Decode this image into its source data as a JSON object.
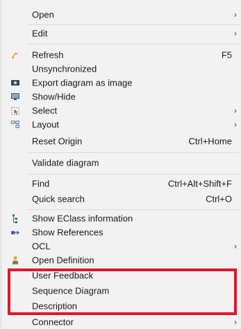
{
  "menu": {
    "items": [
      {
        "label": "Open",
        "shortcut": "",
        "arrow": "›",
        "icon": ""
      },
      {
        "label": "Edit",
        "shortcut": "",
        "arrow": "›",
        "icon": ""
      },
      {
        "label": "Refresh",
        "shortcut": "F5",
        "arrow": "",
        "icon": "refresh-icon"
      },
      {
        "label": "Unsynchronized",
        "shortcut": "",
        "arrow": "",
        "icon": ""
      },
      {
        "label": "Export diagram as image",
        "shortcut": "",
        "arrow": "",
        "icon": "camera-icon"
      },
      {
        "label": "Show/Hide",
        "shortcut": "",
        "arrow": "",
        "icon": "monitor-icon"
      },
      {
        "label": "Select",
        "shortcut": "",
        "arrow": "›",
        "icon": "select-icon"
      },
      {
        "label": "Layout",
        "shortcut": "",
        "arrow": "›",
        "icon": "layout-icon"
      },
      {
        "label": "Reset Origin",
        "shortcut": "Ctrl+Home",
        "arrow": "",
        "icon": ""
      },
      {
        "label": "Validate diagram",
        "shortcut": "",
        "arrow": "",
        "icon": ""
      },
      {
        "label": "Find",
        "shortcut": "Ctrl+Alt+Shift+F",
        "arrow": "",
        "icon": ""
      },
      {
        "label": "Quick search",
        "shortcut": "Ctrl+O",
        "arrow": "",
        "icon": ""
      },
      {
        "label": "Show EClass information",
        "shortcut": "",
        "arrow": "",
        "icon": "eclass-icon"
      },
      {
        "label": "Show References",
        "shortcut": "",
        "arrow": "",
        "icon": "references-icon"
      },
      {
        "label": "OCL",
        "shortcut": "",
        "arrow": "›",
        "icon": ""
      },
      {
        "label": "Open Definition",
        "shortcut": "",
        "arrow": "",
        "icon": "definition-icon"
      },
      {
        "label": "User Feedback",
        "shortcut": "",
        "arrow": "›",
        "icon": ""
      },
      {
        "label": "Sequence Diagram",
        "shortcut": "",
        "arrow": "›",
        "icon": ""
      },
      {
        "label": "Description",
        "shortcut": "",
        "arrow": "›",
        "icon": ""
      },
      {
        "label": "Connector",
        "shortcut": "",
        "arrow": "›",
        "icon": ""
      }
    ]
  },
  "colors": {
    "highlight": "#e0172b",
    "menu_bg": "#f2f2f2",
    "separator": "#d9d9d9",
    "refresh_icon": "#e8a33a",
    "eclass_icon": "#3a8a3a",
    "references_icon": "#4060b0"
  }
}
